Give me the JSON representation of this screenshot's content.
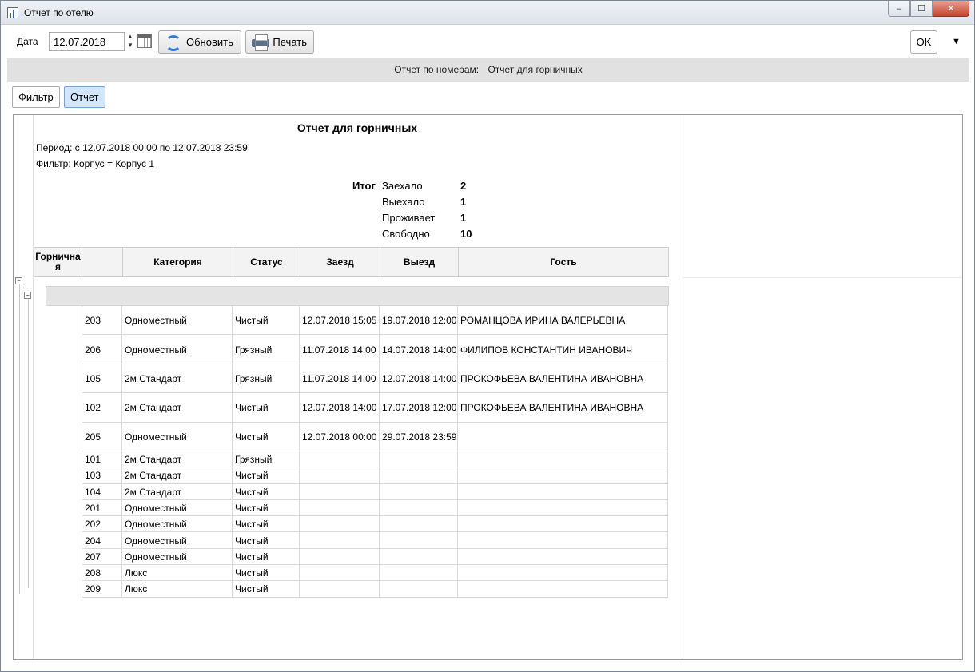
{
  "window": {
    "title": "Отчет по отелю",
    "min": "–",
    "max": "☐",
    "close": "✕"
  },
  "toolbar": {
    "date_label": "Дата",
    "date_value": "12.07.2018",
    "refresh_label": "Обновить",
    "print_label": "Печать",
    "ok_label": "OK",
    "dropdown_arrow": "▼",
    "spin_up": "▲",
    "spin_down": "▼"
  },
  "header": {
    "prefix": "Отчет по номерам:",
    "report_name": "Отчет для горничных"
  },
  "tabs": [
    {
      "label": "Фильтр"
    },
    {
      "label": "Отчет"
    }
  ],
  "report": {
    "title": "Отчет для горничных",
    "period": "Период: с  12.07.2018 00:00 по  12.07.2018 23:59",
    "filter": "Фильтр: Корпус = Корпус 1",
    "summary_title": "Итог",
    "summary": [
      {
        "label": "Заехало",
        "value": "2"
      },
      {
        "label": "Выехало",
        "value": "1"
      },
      {
        "label": "Проживает",
        "value": "1"
      },
      {
        "label": "Свободно",
        "value": "10"
      }
    ],
    "columns": [
      "Горничная",
      "",
      "Категория",
      "Статус",
      "Заезд",
      "Выезд",
      "Гость"
    ],
    "rows": [
      [
        "203",
        "Одноместный",
        "Чистый",
        "12.07.2018 15:05",
        "19.07.2018 12:00",
        "РОМАНЦОВА ИРИНА ВАЛЕРЬЕВНА"
      ],
      [
        "206",
        "Одноместный",
        "Грязный",
        "11.07.2018 14:00",
        "14.07.2018 14:00",
        "ФИЛИПОВ КОНСТАНТИН ИВАНОВИЧ"
      ],
      [
        "105",
        "2м Стандарт",
        "Грязный",
        "11.07.2018 14:00",
        "12.07.2018 14:00",
        "ПРОКОФЬЕВА ВАЛЕНТИНА ИВАНОВНА"
      ],
      [
        "102",
        "2м Стандарт",
        "Чистый",
        "12.07.2018 14:00",
        "17.07.2018 12:00",
        "ПРОКОФЬЕВА ВАЛЕНТИНА ИВАНОВНА"
      ],
      [
        "205",
        "Одноместный",
        "Чистый",
        "12.07.2018 00:00",
        "29.07.2018 23:59",
        ""
      ],
      [
        "101",
        "2м Стандарт",
        "Грязный",
        "",
        "",
        ""
      ],
      [
        "103",
        "2м Стандарт",
        "Чистый",
        "",
        "",
        ""
      ],
      [
        "104",
        "2м Стандарт",
        "Чистый",
        "",
        "",
        ""
      ],
      [
        "201",
        "Одноместный",
        "Чистый",
        "",
        "",
        ""
      ],
      [
        "202",
        "Одноместный",
        "Чистый",
        "",
        "",
        ""
      ],
      [
        "204",
        "Одноместный",
        "Чистый",
        "",
        "",
        ""
      ],
      [
        "207",
        "Одноместный",
        "Чистый",
        "",
        "",
        ""
      ],
      [
        "208",
        "Люкс",
        "Чистый",
        "",
        "",
        ""
      ],
      [
        "209",
        "Люкс",
        "Чистый",
        "",
        "",
        ""
      ]
    ]
  }
}
